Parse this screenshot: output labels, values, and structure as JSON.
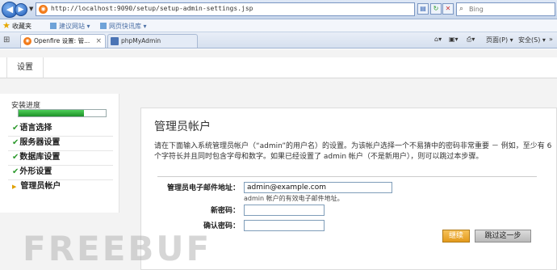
{
  "browser": {
    "url": "http://localhost:9090/setup/setup-admin-settings.jsp",
    "search_placeholder": "Bing",
    "favorites_label": "收藏夹",
    "favorites_items": [
      "建议网站 ▾",
      "网页快讯库 ▾"
    ],
    "tabs": [
      {
        "label": "Openfire 设置: 管..."
      },
      {
        "label": "phpMyAdmin"
      }
    ],
    "toolbar": {
      "page_menu": "页面(P) ▾",
      "safety_menu": "安全(S) ▾"
    }
  },
  "page": {
    "top_nav": "设置",
    "progress_label": "安装进度",
    "progress_percent": 75,
    "steps": [
      {
        "label": "语言选择",
        "done": true
      },
      {
        "label": "服务器设置",
        "done": true
      },
      {
        "label": "数据库设置",
        "done": true
      },
      {
        "label": "外形设置",
        "done": true
      },
      {
        "label": "管理员帐户",
        "done": false
      }
    ],
    "heading": "管理员帐户",
    "description": "请在下面输入系统管理员帐户（“admin”的用户名）的设置。为该帐户选择一个不易猜中的密码非常重要 － 例如，至少有 6 个字符长并且同时包含字母和数字。如果已经设置了 admin 帐户（不是新用户），则可以跳过本步骤。",
    "form": {
      "email_label": "管理员电子邮件地址：",
      "email_value": "admin@example.com",
      "email_hint": "admin 帐户的有效电子邮件地址。",
      "password_label": "新密码：",
      "confirm_label": "确认密码："
    },
    "buttons": {
      "continue": "继续",
      "skip": "跳过这一步"
    },
    "watermark": "FREEBUF"
  }
}
